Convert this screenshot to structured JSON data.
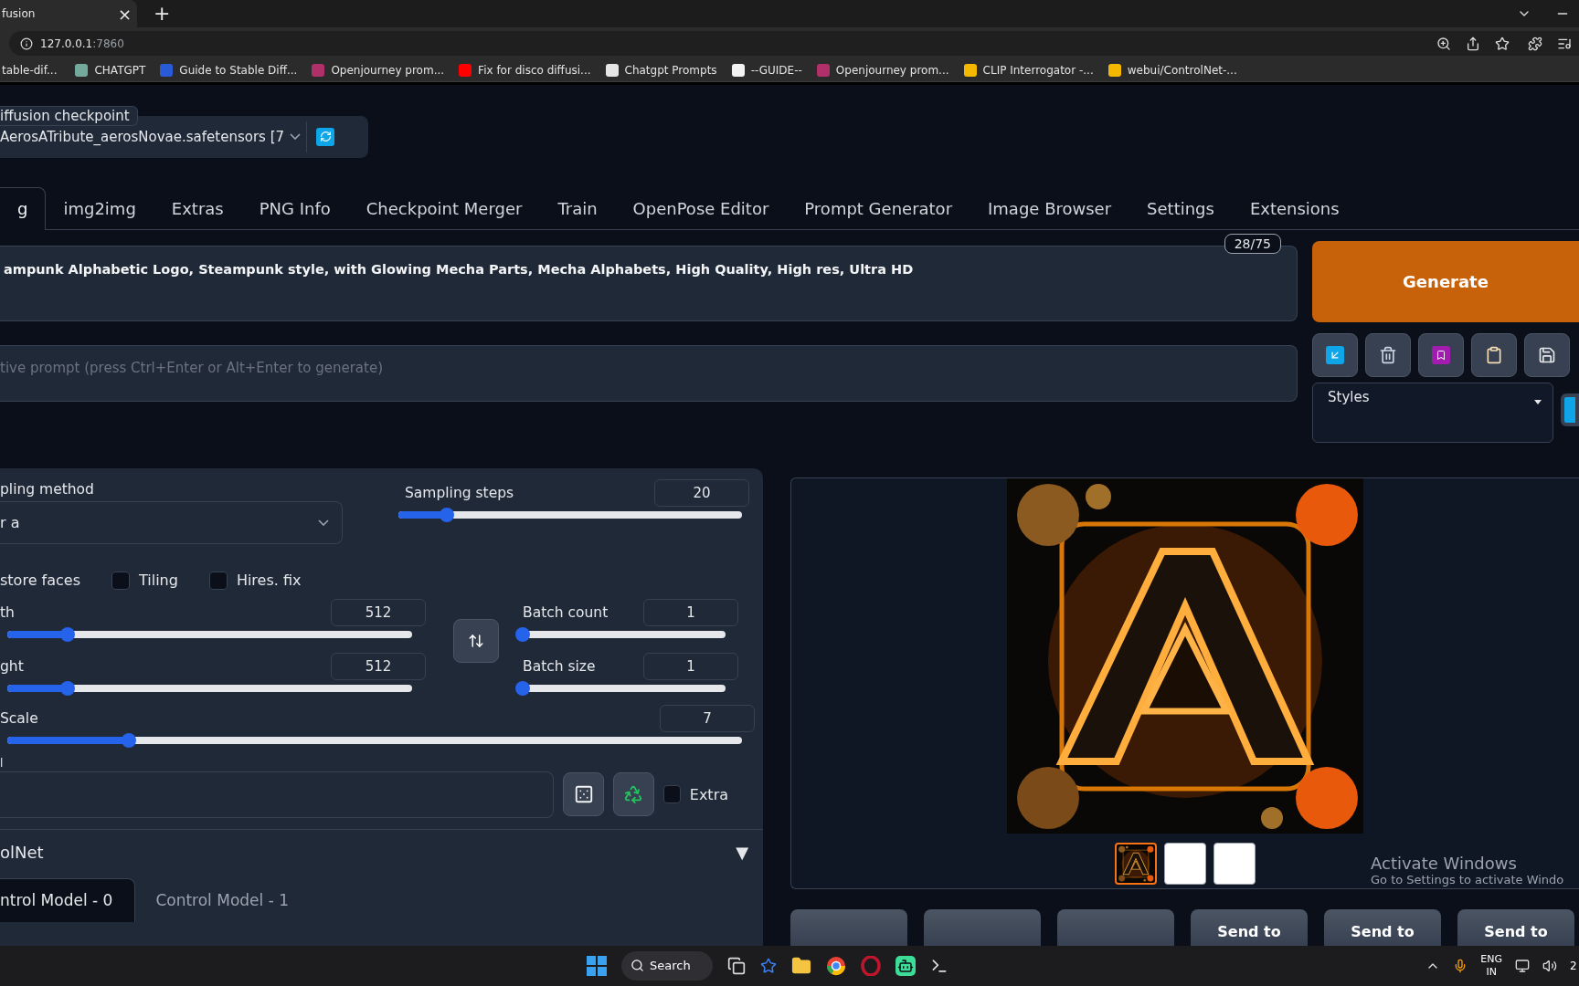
{
  "browser": {
    "tab_title": "fusion",
    "close": "×",
    "new_tab": "+",
    "url_host": "127.0.0.1",
    "url_port": ":7860",
    "bookmarks": [
      {
        "label": "table-dif..."
      },
      {
        "label": "CHATGPT",
        "color": "#74aa9c"
      },
      {
        "label": "Guide to Stable Diff...",
        "color": "#2a5bd7"
      },
      {
        "label": "Openjourney prom...",
        "color": "#b0306a"
      },
      {
        "label": "Fix for disco diffusi...",
        "color": "#ff0000"
      },
      {
        "label": "Chatgpt Prompts",
        "color": "#e6e6e6"
      },
      {
        "label": "--GUIDE--",
        "color": "#f2f2f2"
      },
      {
        "label": "Openjourney prom...",
        "color": "#b0306a"
      },
      {
        "label": "CLIP Interrogator -...",
        "color": "#f5b800"
      },
      {
        "label": "webui/ControlNet-...",
        "color": "#f5b800"
      }
    ]
  },
  "checkpoint": {
    "label": "iffusion checkpoint",
    "value": "AerosATribute_aerosNovae.safetensors [7"
  },
  "tabs": [
    {
      "label": "g",
      "selected": true
    },
    {
      "label": "img2img",
      "selected": false
    },
    {
      "label": "Extras",
      "selected": false
    },
    {
      "label": "PNG Info",
      "selected": false
    },
    {
      "label": "Checkpoint Merger",
      "selected": false
    },
    {
      "label": "Train",
      "selected": false
    },
    {
      "label": "OpenPose Editor",
      "selected": false
    },
    {
      "label": "Prompt Generator",
      "selected": false
    },
    {
      "label": "Image Browser",
      "selected": false
    },
    {
      "label": "Settings",
      "selected": false
    },
    {
      "label": "Extensions",
      "selected": false
    }
  ],
  "prompt": {
    "value": "ampunk Alphabetic Logo, Steampunk style, with Glowing Mecha Parts, Mecha Alphabets, High Quality, High res, Ultra HD",
    "counter": "28/75"
  },
  "negative_prompt": {
    "placeholder": "tive prompt (press Ctrl+Enter or Alt+Enter to generate)"
  },
  "generate": "Generate",
  "styles": {
    "label": "Styles"
  },
  "sampling_method": {
    "label": "pling method",
    "value": "r a"
  },
  "sampling_steps": {
    "label": "Sampling steps",
    "value": "20",
    "level": 0.14
  },
  "checkboxes": [
    {
      "label": "store faces",
      "kind": "cut"
    },
    {
      "label": "Tiling",
      "kind": "box",
      "checked": false
    },
    {
      "label": "Hires. fix",
      "kind": "box",
      "checked": false
    }
  ],
  "size_sliders": [
    {
      "label": "th",
      "value": "512",
      "level": 0.15
    },
    {
      "label": "ght",
      "value": "512",
      "level": 0.15
    }
  ],
  "batch_sliders": [
    {
      "label": "Batch count",
      "value": "1",
      "level": 0
    },
    {
      "label": "Batch size",
      "value": "1",
      "level": 0
    }
  ],
  "cfg": {
    "label": "Scale",
    "value": "7",
    "level": 0.166
  },
  "seed": {
    "label": "l",
    "extra": {
      "label": "Extra",
      "checked": false
    }
  },
  "controlnet": {
    "title": "olNet",
    "toggle": "▼",
    "tabs": [
      {
        "label": "ntrol Model - 0",
        "selected": true
      },
      {
        "label": "Control Model - 1",
        "selected": false
      }
    ]
  },
  "gallery": {
    "thumbnails": [
      {
        "kind": "picture",
        "selected": true
      },
      {
        "kind": "blank",
        "selected": false
      },
      {
        "kind": "blank",
        "selected": false
      }
    ]
  },
  "output_buttons": [
    {
      "kind": "blank"
    },
    {
      "kind": "blank"
    },
    {
      "kind": "blank"
    },
    {
      "kind": "text",
      "label": "Send to"
    },
    {
      "kind": "text",
      "label": "Send to"
    },
    {
      "kind": "text",
      "label": "Send to"
    }
  ],
  "os_notice": {
    "title": "Activate Windows",
    "subtitle": "Go to Settings to activate Windo"
  },
  "taskbar": {
    "search": "Search",
    "language": "ENG",
    "region": "IN",
    "clock": "2"
  }
}
